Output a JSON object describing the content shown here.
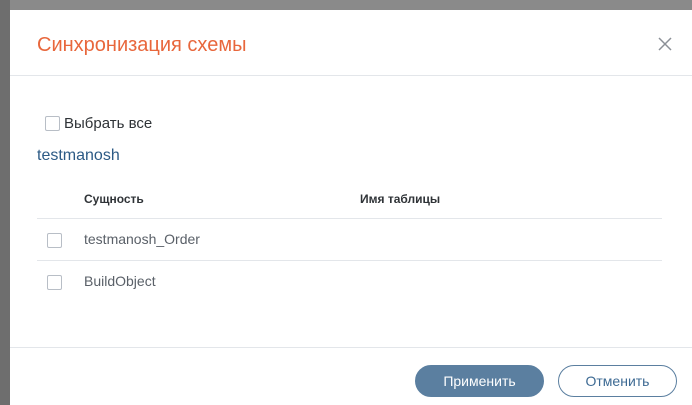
{
  "dialog": {
    "title": "Синхронизация схемы",
    "close_icon": "close-icon"
  },
  "select_all": {
    "label": "Выбрать все",
    "checked": false
  },
  "group": {
    "title": "testmanosh"
  },
  "table": {
    "headers": {
      "entity": "Сущность",
      "table_name": "Имя таблицы"
    },
    "rows": [
      {
        "entity": "testmanosh_Order",
        "table_name": "",
        "checked": false
      },
      {
        "entity": "BuildObject",
        "table_name": "",
        "checked": false
      }
    ]
  },
  "footer": {
    "apply_label": "Применить",
    "cancel_label": "Отменить"
  },
  "colors": {
    "title": "#e8673c",
    "group_title": "#2c5a85",
    "primary_button": "#5b7fa0"
  }
}
